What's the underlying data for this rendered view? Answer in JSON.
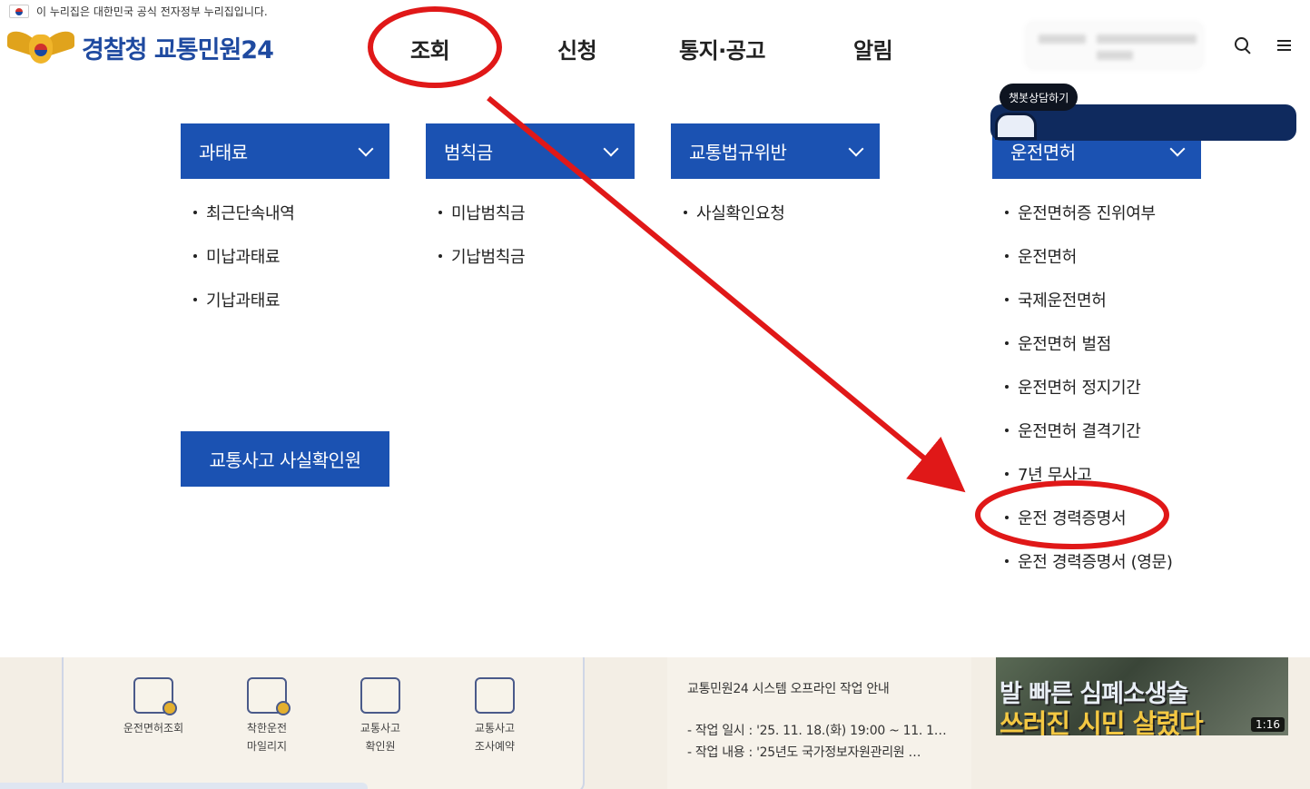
{
  "gov_banner": {
    "text": "이 누리집은 대한민국 공식 전자정부 누리집입니다."
  },
  "header": {
    "logo_text": "경찰청 교통민원24",
    "gnb": [
      "조회",
      "신청",
      "통지·공고",
      "알림"
    ]
  },
  "menu": {
    "columns": [
      {
        "title": "과태료",
        "items": [
          "최근단속내역",
          "미납과태료",
          "기납과태료"
        ]
      },
      {
        "title": "범칙금",
        "items": [
          "미납범칙금",
          "기납범칙금"
        ]
      },
      {
        "title": "교통법규위반",
        "items": [
          "사실확인요청"
        ]
      },
      {
        "title": "운전면허",
        "items": [
          "운전면허증 진위여부",
          "운전면허",
          "국제운전면허",
          "운전면허 벌점",
          "운전면허 정지기간",
          "운전면허 결격기간",
          "7년 무사고",
          "운전 경력증명서",
          "운전 경력증명서 (영문)"
        ]
      }
    ],
    "accident_button": "교통사고 사실확인원"
  },
  "quick_menu": [
    {
      "label_line1": "운전면허조회",
      "label_line2": ""
    },
    {
      "label_line1": "착한운전",
      "label_line2": "마일리지"
    },
    {
      "label_line1": "교통사고",
      "label_line2": "확인원"
    },
    {
      "label_line1": "교통사고",
      "label_line2": "조사예약"
    }
  ],
  "notice": {
    "title": "교통민원24 시스템 오프라인 작업 안내",
    "line1": "- 작업 일시 : '25. 11. 18.(화) 19:00 ~ 11. 1…",
    "line2": "- 작업 내용 : '25년도 국가정보자원관리원 …"
  },
  "video": {
    "caption1": "발 빠른 심폐소생술",
    "caption2": "쓰러진 시민 살렸다",
    "duration": "1:16"
  },
  "chat": {
    "label": "챗봇상담하기"
  },
  "annotation_colors": {
    "circle": "#e01818",
    "arrow": "#e01818"
  }
}
